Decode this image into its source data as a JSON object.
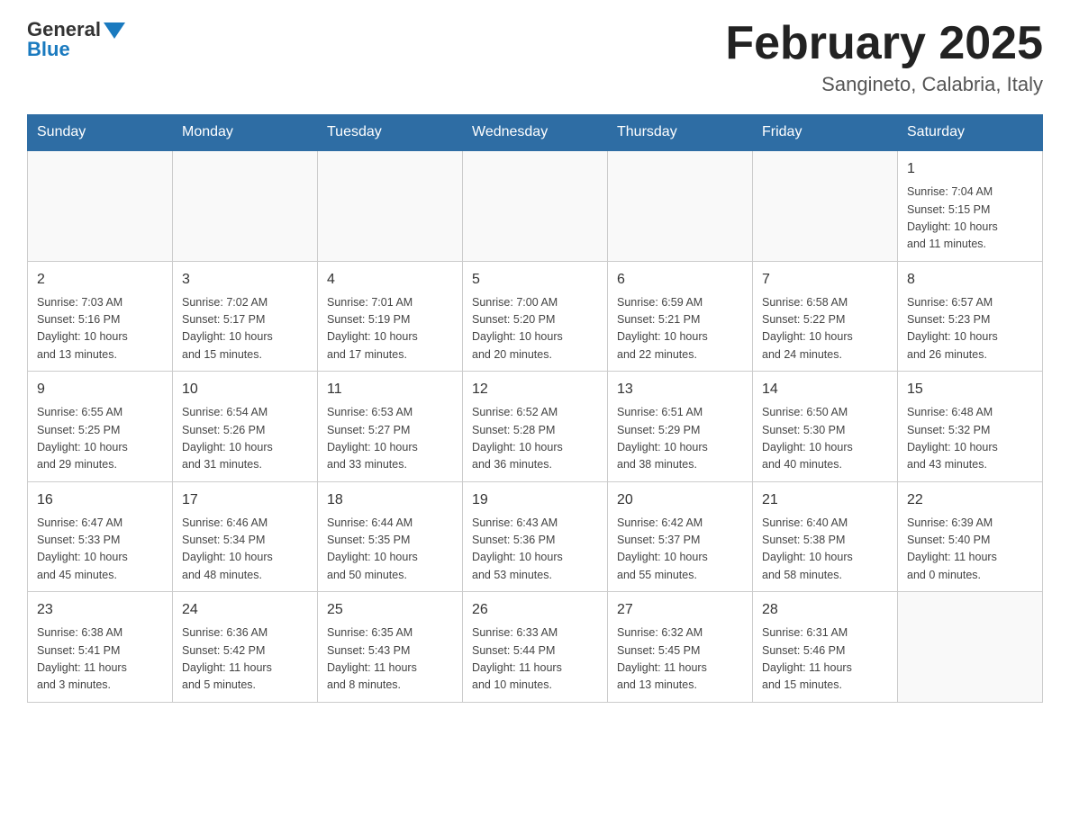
{
  "header": {
    "logo_general": "General",
    "logo_blue": "Blue",
    "month_title": "February 2025",
    "location": "Sangineto, Calabria, Italy"
  },
  "weekdays": [
    "Sunday",
    "Monday",
    "Tuesday",
    "Wednesday",
    "Thursday",
    "Friday",
    "Saturday"
  ],
  "weeks": [
    [
      {
        "day": "",
        "info": ""
      },
      {
        "day": "",
        "info": ""
      },
      {
        "day": "",
        "info": ""
      },
      {
        "day": "",
        "info": ""
      },
      {
        "day": "",
        "info": ""
      },
      {
        "day": "",
        "info": ""
      },
      {
        "day": "1",
        "info": "Sunrise: 7:04 AM\nSunset: 5:15 PM\nDaylight: 10 hours\nand 11 minutes."
      }
    ],
    [
      {
        "day": "2",
        "info": "Sunrise: 7:03 AM\nSunset: 5:16 PM\nDaylight: 10 hours\nand 13 minutes."
      },
      {
        "day": "3",
        "info": "Sunrise: 7:02 AM\nSunset: 5:17 PM\nDaylight: 10 hours\nand 15 minutes."
      },
      {
        "day": "4",
        "info": "Sunrise: 7:01 AM\nSunset: 5:19 PM\nDaylight: 10 hours\nand 17 minutes."
      },
      {
        "day": "5",
        "info": "Sunrise: 7:00 AM\nSunset: 5:20 PM\nDaylight: 10 hours\nand 20 minutes."
      },
      {
        "day": "6",
        "info": "Sunrise: 6:59 AM\nSunset: 5:21 PM\nDaylight: 10 hours\nand 22 minutes."
      },
      {
        "day": "7",
        "info": "Sunrise: 6:58 AM\nSunset: 5:22 PM\nDaylight: 10 hours\nand 24 minutes."
      },
      {
        "day": "8",
        "info": "Sunrise: 6:57 AM\nSunset: 5:23 PM\nDaylight: 10 hours\nand 26 minutes."
      }
    ],
    [
      {
        "day": "9",
        "info": "Sunrise: 6:55 AM\nSunset: 5:25 PM\nDaylight: 10 hours\nand 29 minutes."
      },
      {
        "day": "10",
        "info": "Sunrise: 6:54 AM\nSunset: 5:26 PM\nDaylight: 10 hours\nand 31 minutes."
      },
      {
        "day": "11",
        "info": "Sunrise: 6:53 AM\nSunset: 5:27 PM\nDaylight: 10 hours\nand 33 minutes."
      },
      {
        "day": "12",
        "info": "Sunrise: 6:52 AM\nSunset: 5:28 PM\nDaylight: 10 hours\nand 36 minutes."
      },
      {
        "day": "13",
        "info": "Sunrise: 6:51 AM\nSunset: 5:29 PM\nDaylight: 10 hours\nand 38 minutes."
      },
      {
        "day": "14",
        "info": "Sunrise: 6:50 AM\nSunset: 5:30 PM\nDaylight: 10 hours\nand 40 minutes."
      },
      {
        "day": "15",
        "info": "Sunrise: 6:48 AM\nSunset: 5:32 PM\nDaylight: 10 hours\nand 43 minutes."
      }
    ],
    [
      {
        "day": "16",
        "info": "Sunrise: 6:47 AM\nSunset: 5:33 PM\nDaylight: 10 hours\nand 45 minutes."
      },
      {
        "day": "17",
        "info": "Sunrise: 6:46 AM\nSunset: 5:34 PM\nDaylight: 10 hours\nand 48 minutes."
      },
      {
        "day": "18",
        "info": "Sunrise: 6:44 AM\nSunset: 5:35 PM\nDaylight: 10 hours\nand 50 minutes."
      },
      {
        "day": "19",
        "info": "Sunrise: 6:43 AM\nSunset: 5:36 PM\nDaylight: 10 hours\nand 53 minutes."
      },
      {
        "day": "20",
        "info": "Sunrise: 6:42 AM\nSunset: 5:37 PM\nDaylight: 10 hours\nand 55 minutes."
      },
      {
        "day": "21",
        "info": "Sunrise: 6:40 AM\nSunset: 5:38 PM\nDaylight: 10 hours\nand 58 minutes."
      },
      {
        "day": "22",
        "info": "Sunrise: 6:39 AM\nSunset: 5:40 PM\nDaylight: 11 hours\nand 0 minutes."
      }
    ],
    [
      {
        "day": "23",
        "info": "Sunrise: 6:38 AM\nSunset: 5:41 PM\nDaylight: 11 hours\nand 3 minutes."
      },
      {
        "day": "24",
        "info": "Sunrise: 6:36 AM\nSunset: 5:42 PM\nDaylight: 11 hours\nand 5 minutes."
      },
      {
        "day": "25",
        "info": "Sunrise: 6:35 AM\nSunset: 5:43 PM\nDaylight: 11 hours\nand 8 minutes."
      },
      {
        "day": "26",
        "info": "Sunrise: 6:33 AM\nSunset: 5:44 PM\nDaylight: 11 hours\nand 10 minutes."
      },
      {
        "day": "27",
        "info": "Sunrise: 6:32 AM\nSunset: 5:45 PM\nDaylight: 11 hours\nand 13 minutes."
      },
      {
        "day": "28",
        "info": "Sunrise: 6:31 AM\nSunset: 5:46 PM\nDaylight: 11 hours\nand 15 minutes."
      },
      {
        "day": "",
        "info": ""
      }
    ]
  ]
}
